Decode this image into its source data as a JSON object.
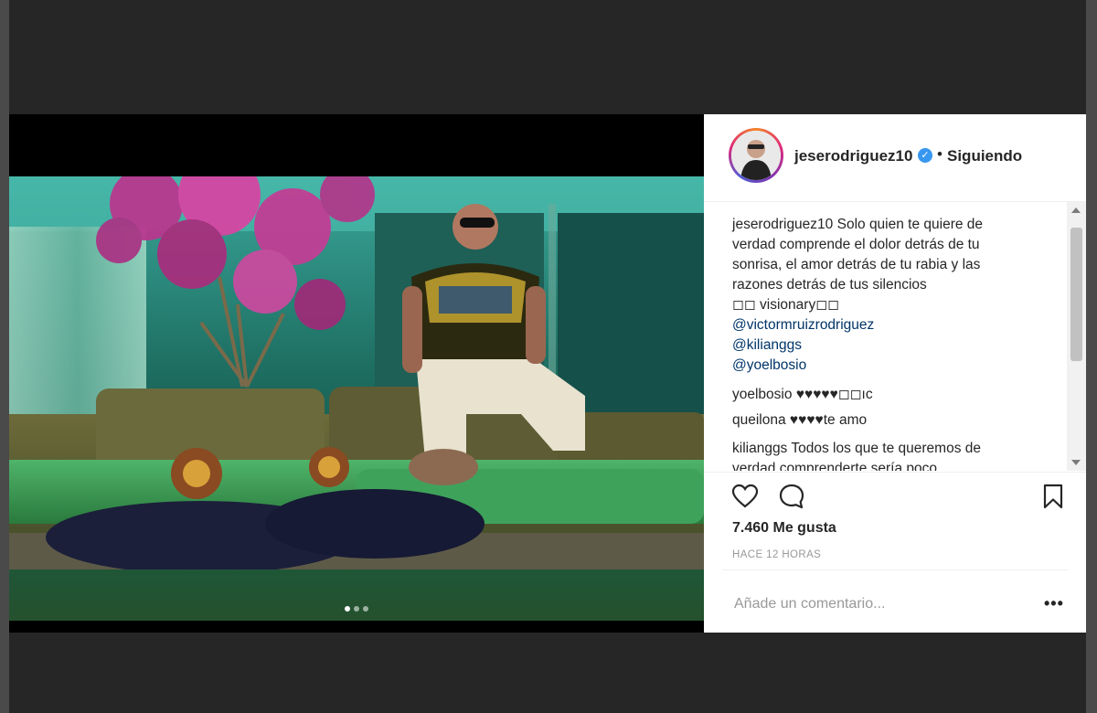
{
  "post": {
    "username": "jeserodriguez10",
    "follow_status": "Siguiendo",
    "separator": "•",
    "verified_glyph": "✓",
    "caption_user": "jeserodriguez10",
    "caption_lines": [
      "Solo quien te quiere de",
      "verdad comprende el dolor detrás de tu",
      "sonrisa, el amor detrás de tu rabia y las",
      "razones detrás de tus silencios",
      "◻◻ visionary◻◻"
    ],
    "caption_mentions": [
      "@victormruizrodriguez",
      "@kilianggs",
      "@yoelbosio"
    ],
    "comments": [
      {
        "user": "yoelbosio",
        "text": "♥♥♥♥♥◻◻ıc"
      },
      {
        "user": "queilona",
        "text": "♥♥♥♥te amo"
      },
      {
        "user": "kilianggs",
        "text": "Todos los que te queremos de"
      },
      {
        "user": "",
        "text": "verdad comprenderte sería poco"
      }
    ],
    "likes": "7.460 Me gusta",
    "timestamp": "HACE 12 HORAS",
    "comment_placeholder": "Añade un comentario...",
    "more_label": "•••",
    "carousel": {
      "count": 3,
      "active": 1
    }
  },
  "icons": {
    "verified": "verified-badge-icon",
    "like": "heart-icon",
    "comment": "comment-bubble-icon",
    "save": "bookmark-icon",
    "more": "ellipsis-icon"
  },
  "colors": {
    "background": "#262626",
    "panel": "#ffffff",
    "mention": "#003569",
    "verified": "#3897f0",
    "muted": "#999999"
  }
}
